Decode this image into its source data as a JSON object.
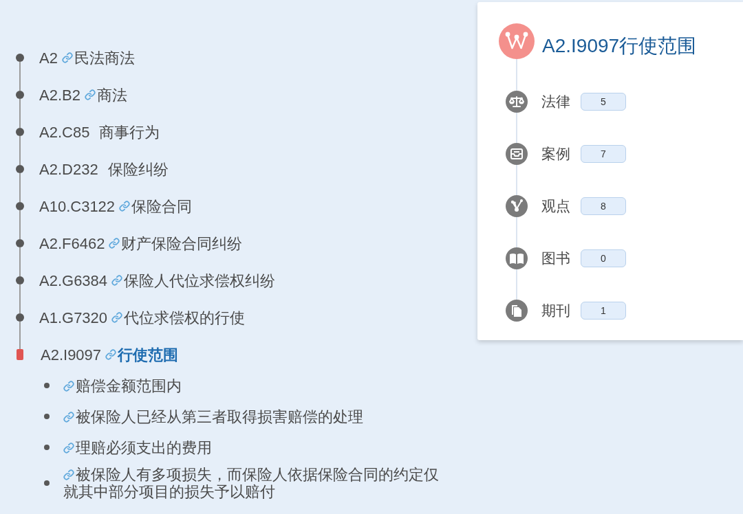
{
  "path": [
    {
      "code": "A2",
      "title": "民法商法",
      "linked": true,
      "selected": false
    },
    {
      "code": "A2.B2",
      "title": "商法",
      "linked": true,
      "selected": false
    },
    {
      "code": "A2.C85",
      "title": "商事行为",
      "linked": false,
      "selected": false
    },
    {
      "code": "A2.D232",
      "title": "保险纠纷",
      "linked": false,
      "selected": false
    },
    {
      "code": "A10.C3122",
      "title": "保险合同",
      "linked": true,
      "selected": false
    },
    {
      "code": "A2.F6462",
      "title": "财产保险合同纠纷",
      "linked": true,
      "selected": false
    },
    {
      "code": "A2.G6384",
      "title": "保险人代位求偿权纠纷",
      "linked": true,
      "selected": false
    },
    {
      "code": "A1.G7320",
      "title": "代位求偿权的行使",
      "linked": true,
      "selected": false
    },
    {
      "code": "A2.I9097",
      "title": "行使范围",
      "linked": true,
      "selected": true,
      "children": [
        {
          "title": "赔偿金额范围内",
          "linked": true
        },
        {
          "title": "被保险人已经从第三者取得损害赔偿的处理",
          "linked": true
        },
        {
          "title": "理赔必须支出的费用",
          "linked": true
        },
        {
          "title": "被保险人有多项损失，而保险人依据保险合同的约定仅就其中部分项目的损失予以赔付",
          "linked": true
        }
      ]
    }
  ],
  "detail": {
    "title": "A2.I9097行使范围",
    "resources": [
      {
        "label": "法律",
        "count": "5"
      },
      {
        "label": "案例",
        "count": "7"
      },
      {
        "label": "观点",
        "count": "8"
      },
      {
        "label": "图书",
        "count": "0"
      },
      {
        "label": "期刊",
        "count": "1"
      }
    ]
  }
}
